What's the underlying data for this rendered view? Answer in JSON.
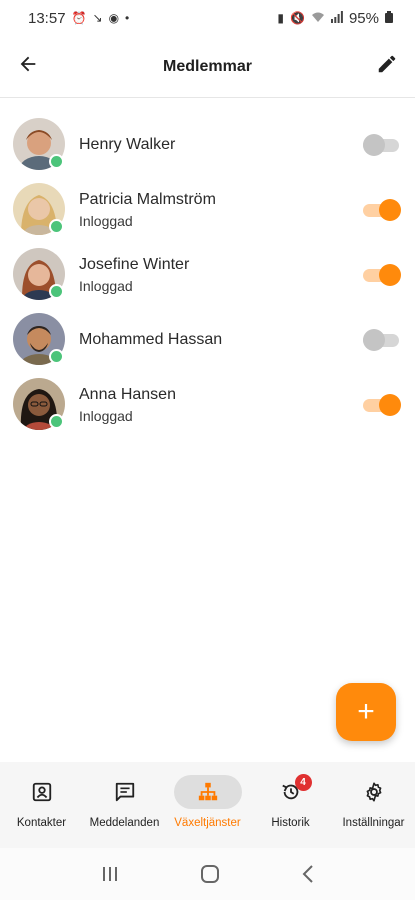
{
  "statusbar": {
    "time": "13:57",
    "battery": "95%"
  },
  "appbar": {
    "title": "Medlemmar"
  },
  "members": [
    {
      "name": "Henry Walker",
      "status": "",
      "enabled": false,
      "skin": "#d9a17e",
      "hair": "#8a4a25",
      "bg": "#d8d0c8"
    },
    {
      "name": "Patricia Malmström",
      "status": "Inloggad",
      "enabled": true,
      "skin": "#eac7a8",
      "hair": "#d9b26b",
      "bg": "#e8d9b8"
    },
    {
      "name": "Josefine Winter",
      "status": "Inloggad",
      "enabled": true,
      "skin": "#e6b79a",
      "hair": "#9c4f2c",
      "bg": "#cfc7bf"
    },
    {
      "name": "Mohammed Hassan",
      "status": "",
      "enabled": false,
      "skin": "#c58a5e",
      "hair": "#2e2520",
      "bg": "#8a8fa3"
    },
    {
      "name": "Anna Hansen",
      "status": "Inloggad",
      "enabled": true,
      "skin": "#8a5a3c",
      "hair": "#1f1712",
      "bg": "#bba98f"
    }
  ],
  "fab": {
    "symbol": "+"
  },
  "nav": [
    {
      "label": "Kontakter",
      "icon": "contact-card-icon",
      "active": false
    },
    {
      "label": "Meddelanden",
      "icon": "message-icon",
      "active": false
    },
    {
      "label": "Växeltjänster",
      "icon": "org-chart-icon",
      "active": true
    },
    {
      "label": "Historik",
      "icon": "history-icon",
      "active": false,
      "badge": "4"
    },
    {
      "label": "Inställningar",
      "icon": "gear-icon",
      "active": false
    }
  ],
  "colors": {
    "accent": "#ff8a0c",
    "online": "#4cc47a",
    "badge": "#e03131"
  }
}
